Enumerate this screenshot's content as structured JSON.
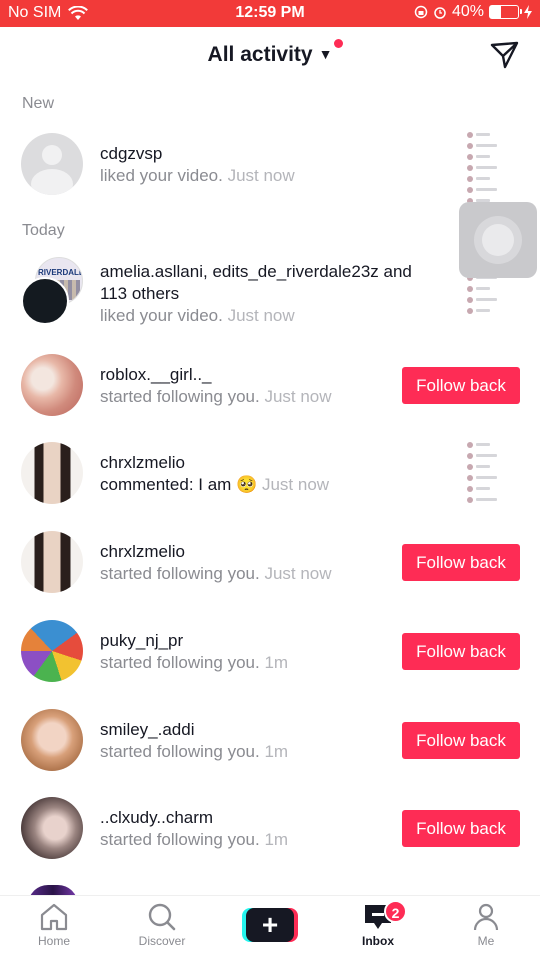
{
  "status_bar": {
    "carrier": "No SIM",
    "time": "12:59 PM",
    "battery": "40%",
    "battery_level": 0.4
  },
  "header": {
    "title": "All activity",
    "caret": "▼"
  },
  "sections": {
    "new": "New",
    "today": "Today"
  },
  "notifications": [
    {
      "name": "cdgzvsp",
      "action": "liked your video.",
      "time": "Just now"
    },
    {
      "name_line1": "amelia.asllani, edits_de_riverdale23z and",
      "name_line2": "113 others",
      "action": "liked your video.",
      "time": "Just now",
      "avatar_text": "RIVERDALE"
    },
    {
      "name": "roblox.__girl.._",
      "action": "started following you.",
      "time": "Just now",
      "button": "Follow back"
    },
    {
      "name": "chrxlzmelio",
      "action": "commented: I am",
      "emoji": "🥺",
      "time": "Just now"
    },
    {
      "name": "chrxlzmelio",
      "action": "started following you.",
      "time": "Just now",
      "button": "Follow back"
    },
    {
      "name": "puky_nj_pr",
      "action": "started following you.",
      "time": "1m",
      "button": "Follow back"
    },
    {
      "name": "smiley_.addi",
      "action": "started following you.",
      "time": "1m",
      "button": "Follow back"
    },
    {
      "name": "..clxudy..charm",
      "action": "started following you.",
      "time": "1m",
      "button": "Follow back"
    }
  ],
  "tabbar": {
    "home": "Home",
    "discover": "Discover",
    "create": "+",
    "inbox": "Inbox",
    "inbox_badge": "2",
    "me": "Me"
  },
  "colors": {
    "accent": "#fe2c55",
    "status_bar": "#f23a39"
  }
}
